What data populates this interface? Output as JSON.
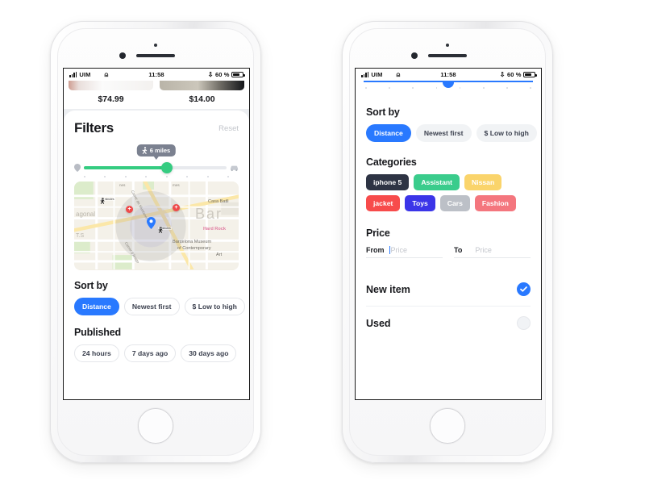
{
  "status_bar": {
    "carrier": "UIM",
    "time": "11:58",
    "battery_percent": "60 %",
    "wifi_icon": "wifi-icon",
    "bluetooth_icon": "bluetooth-icon",
    "signal_icon": "signal-bars-icon",
    "battery_icon": "battery-icon"
  },
  "colors": {
    "accent_blue": "#2979ff",
    "slider_green": "#35cc81",
    "badge_gray": "#7b8190"
  },
  "phone1": {
    "products": [
      {
        "price": "$74.99"
      },
      {
        "price": "$14.00"
      }
    ],
    "filters": {
      "title": "Filters",
      "reset_label": "Reset",
      "distance_badge": {
        "value": "6 miles",
        "icon": "walking-person-icon"
      },
      "slider": {
        "start_icon": "map-pin-icon",
        "end_icon": "car-icon",
        "fill_percent": 58
      }
    },
    "map": {
      "labels": [
        "Carrer de Muntaner",
        "Casa Batll",
        "Bar",
        "Hard Rock",
        "Barcelona Museum",
        "of Contemporary",
        "Art",
        "agonal",
        "T.S",
        "Carrer d'Arago",
        "mes",
        "nes"
      ],
      "walk_times": [
        "10 minutes",
        "5 minutes"
      ],
      "user_pin_icon": "location-marker-icon",
      "poi_icon": "plus-marker-icon"
    },
    "sort_by": {
      "title": "Sort by",
      "options": [
        {
          "label": "Distance",
          "selected": true
        },
        {
          "label": "Newest first",
          "selected": false
        },
        {
          "label": "$ Low to high",
          "selected": false
        }
      ]
    },
    "published": {
      "title": "Published",
      "options": [
        {
          "label": "24 hours",
          "selected": false
        },
        {
          "label": "7 days ago",
          "selected": false
        },
        {
          "label": "30 days ago",
          "selected": false
        }
      ]
    }
  },
  "phone2": {
    "sort_by": {
      "title": "Sort by",
      "options": [
        {
          "label": "Distance",
          "selected": true
        },
        {
          "label": "Newest first",
          "selected": false
        },
        {
          "label": "$ Low to high",
          "selected": false
        }
      ]
    },
    "categories": {
      "title": "Categories",
      "rows": [
        [
          {
            "label": "iphone 5",
            "color": "#2e3444"
          },
          {
            "label": "Assistant",
            "color": "#3acc8c"
          },
          {
            "label": "Nissan",
            "color": "#fad46b"
          }
        ],
        [
          {
            "label": "jacket",
            "color": "#f74b4b"
          },
          {
            "label": "Toys",
            "color": "#3b35e8"
          },
          {
            "label": "Cars",
            "color": "#bcc0c7"
          },
          {
            "label": "Fashion",
            "color": "#f4767e"
          }
        ]
      ]
    },
    "price": {
      "title": "Price",
      "from_label": "From",
      "from_value": "",
      "from_placeholder": "Price",
      "to_label": "To",
      "to_value": "",
      "to_placeholder": "Price"
    },
    "condition": [
      {
        "label": "New item",
        "selected": true
      },
      {
        "label": "Used",
        "selected": false
      }
    ]
  }
}
